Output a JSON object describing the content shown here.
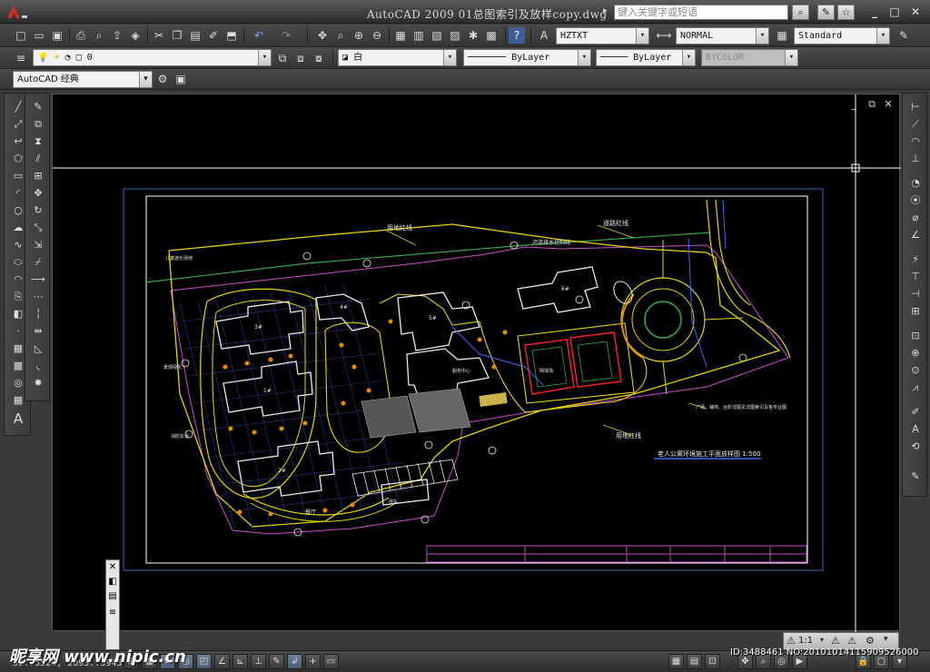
{
  "window": {
    "title": "AutoCAD  2009  01总图索引及放样copy.dwg",
    "search_placeholder": "键入关键字或短语",
    "controls": {
      "minimize": "_",
      "restore": "□",
      "close": "✕"
    }
  },
  "toolbar_styles": {
    "text_style": "HZTXT",
    "dim_style": "NORMAL",
    "table_style": "Standard"
  },
  "layers_bar": {
    "current_layer": "0",
    "color": "白",
    "linetype": "ByLayer",
    "lineweight": "ByLayer",
    "plotstyle": "BYCOLOR"
  },
  "workspace": {
    "name": "AutoCAD 经典"
  },
  "drawing": {
    "labels": {
      "road_red_line_top": "用地红线",
      "road_red_line_bottom": "用地红线",
      "city_road": "道路红线",
      "drainage": "河道排水控制线",
      "plan_title": "老人公寓环境施工平面放样图  1:500",
      "court": "网球场",
      "parking": "停车",
      "note": "广场、铺地、台阶详图见详图索引及各专业图",
      "left_note_1": "儿童游乐场地",
      "left_note_2": "景观绿化",
      "left_note_3": "消防车道",
      "bldg_a": "3#",
      "bldg_b": "1#",
      "bldg_c": "2#",
      "bldg_d": "4#",
      "bldg_e": "5#",
      "bldg_f": "6#",
      "canteen": "餐厅",
      "service": "服务中心"
    }
  },
  "statusbar": {
    "coords": "52..5524, 2093..3945, 0",
    "annotation_scale": "1:1"
  },
  "watermark": {
    "site": "昵享网 www.nipic.cn",
    "id": "ID:3488461 NO:20101014115909526000"
  }
}
